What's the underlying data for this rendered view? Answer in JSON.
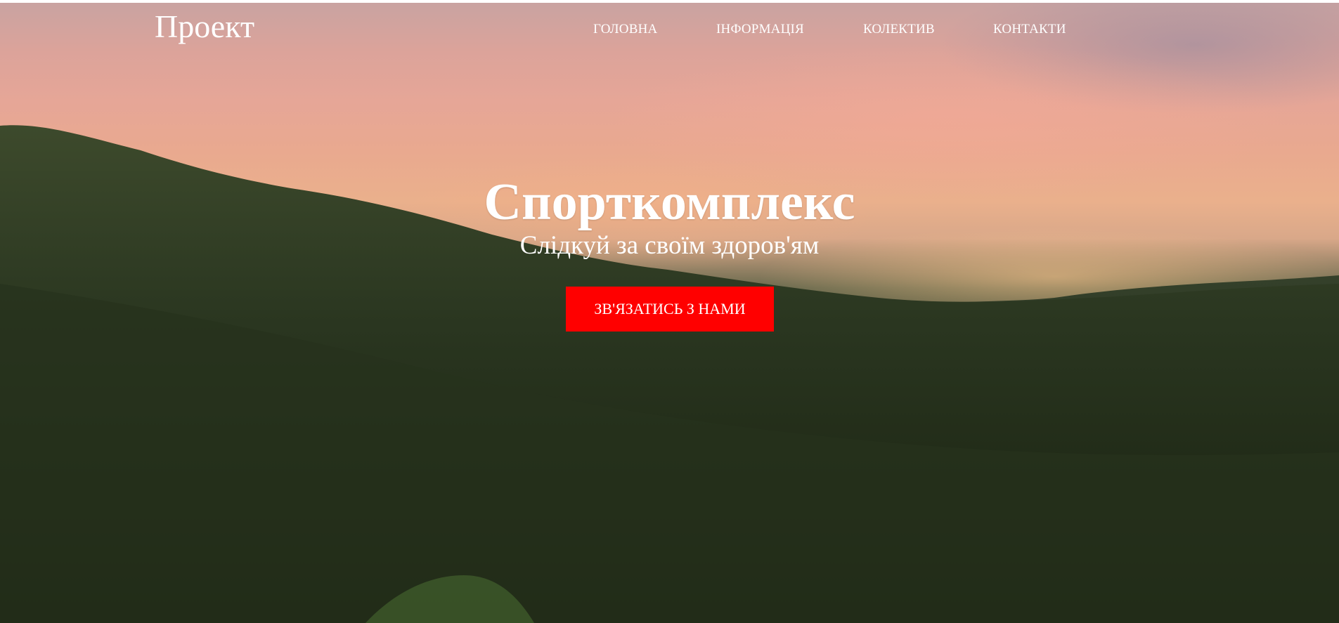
{
  "header": {
    "brand": "Проект",
    "nav": {
      "home": "ГОЛОВНА",
      "info": "ІНФОРМАЦІЯ",
      "team": "КОЛЕКТИВ",
      "contacts": "КОНТАКТИ"
    }
  },
  "hero": {
    "title": "Спорткомплекс",
    "subtitle": "Слідкуй за своїм здоров'ям",
    "cta_label": "ЗВ'ЯЗАТИСЬ З НАМИ",
    "background": "sunset-forest-image"
  },
  "colors": {
    "cta_background": "#ff0000",
    "text": "#ffffff"
  }
}
